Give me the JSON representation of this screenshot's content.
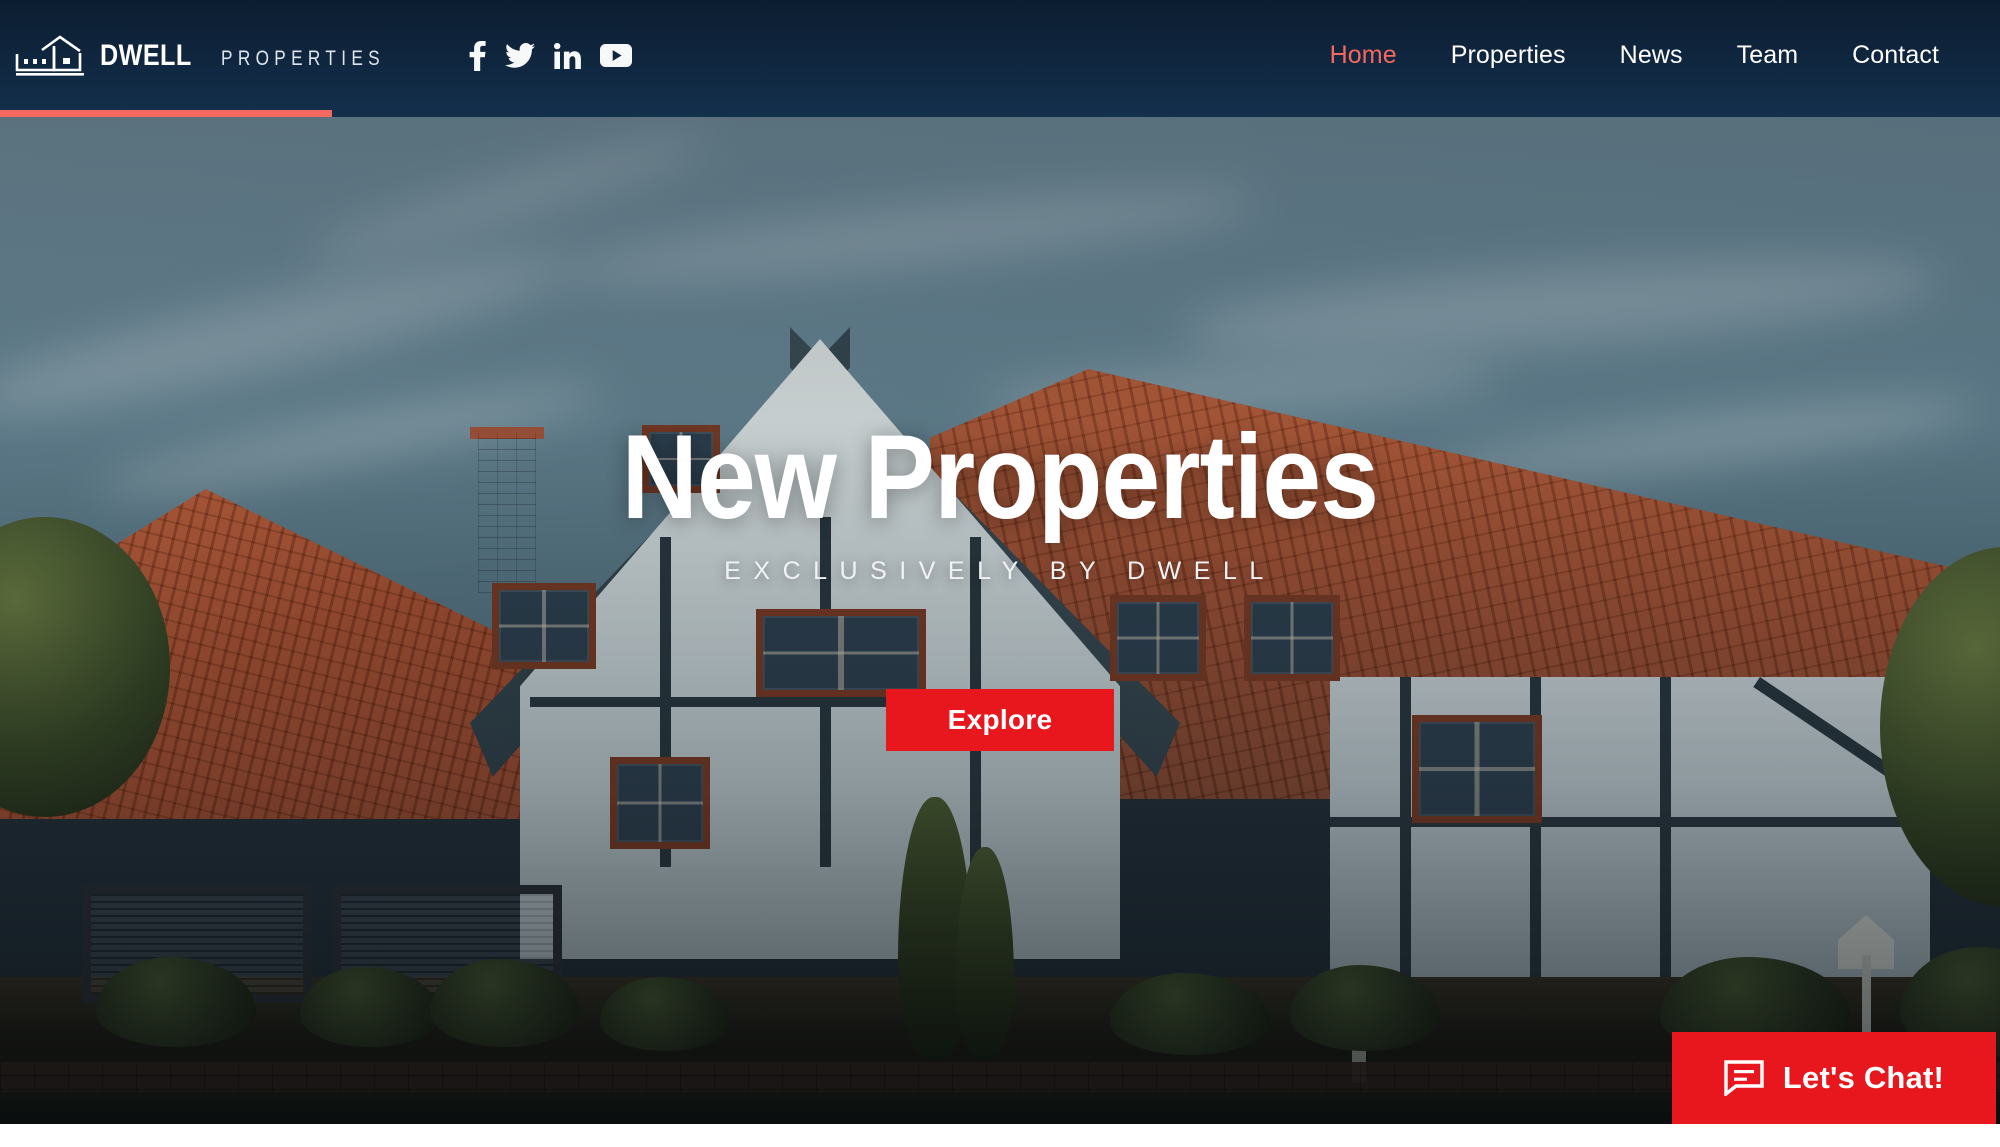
{
  "header": {
    "logo": {
      "icon": "house-outline-icon",
      "brand_primary": "DWELL",
      "brand_secondary": "PROPERTIES"
    },
    "social": [
      {
        "name": "facebook-icon",
        "label": "Facebook"
      },
      {
        "name": "twitter-icon",
        "label": "Twitter"
      },
      {
        "name": "linkedin-icon",
        "label": "LinkedIn"
      },
      {
        "name": "youtube-icon",
        "label": "YouTube"
      }
    ],
    "nav": [
      {
        "label": "Home",
        "active": true
      },
      {
        "label": "Properties",
        "active": false
      },
      {
        "label": "News",
        "active": false
      },
      {
        "label": "Team",
        "active": false
      },
      {
        "label": "Contact",
        "active": false
      }
    ],
    "accent_color": "#f4695f",
    "background_color": "#0c1d30"
  },
  "hero": {
    "title": "New Properties",
    "subtitle": "EXCLUSIVELY BY DWELL",
    "cta_label": "Explore",
    "cta_color": "#e8161d",
    "image_alt": "Tudor-style house with terracotta tile roof at dusk"
  },
  "chat_widget": {
    "label": "Let's Chat!",
    "icon": "chat-bubble-icon",
    "background_color": "#e8161d"
  }
}
